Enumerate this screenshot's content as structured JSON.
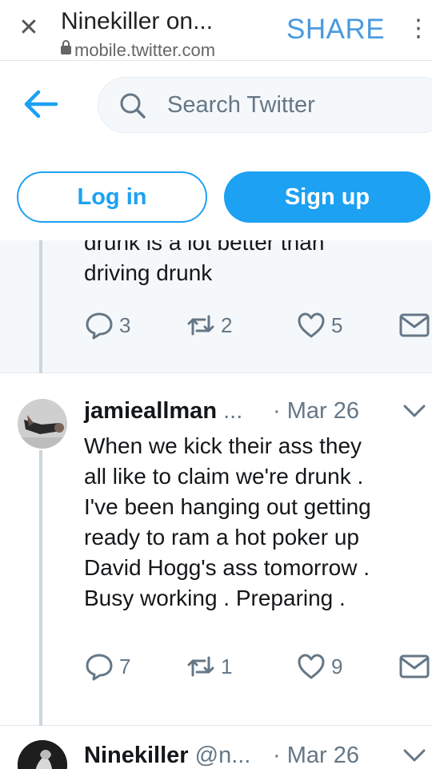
{
  "browser": {
    "title": "Ninekiller on...",
    "url": "mobile.twitter.com",
    "share_label": "SHARE",
    "close_icon": "close-icon",
    "menu_icon": "more-vert-icon"
  },
  "header": {
    "search_placeholder": "Search Twitter",
    "back_icon": "back-arrow-icon"
  },
  "auth": {
    "login_label": "Log in",
    "signup_label": "Sign up"
  },
  "colors": {
    "accent": "#1da1f2",
    "muted": "#657786",
    "background_alt": "#f5f8fa"
  },
  "tweets": [
    {
      "text_partial_top": "drunk is a lot better than",
      "text_lines": [
        "driving drunk"
      ],
      "replies": "3",
      "retweets": "2",
      "likes": "5"
    },
    {
      "author": "jamieallman",
      "handle": "...",
      "date": "Mar 26",
      "text_lines": [
        "When we kick their ass they",
        "all like to claim we're drunk .",
        "I've been hanging out getting",
        "ready to ram a hot poker up",
        "David Hogg's ass tomorrow .",
        "Busy working . Preparing ."
      ],
      "replies": "7",
      "retweets": "1",
      "likes": "9"
    },
    {
      "author": "Ninekiller",
      "handle": "@n...",
      "date": "Mar 26"
    }
  ]
}
